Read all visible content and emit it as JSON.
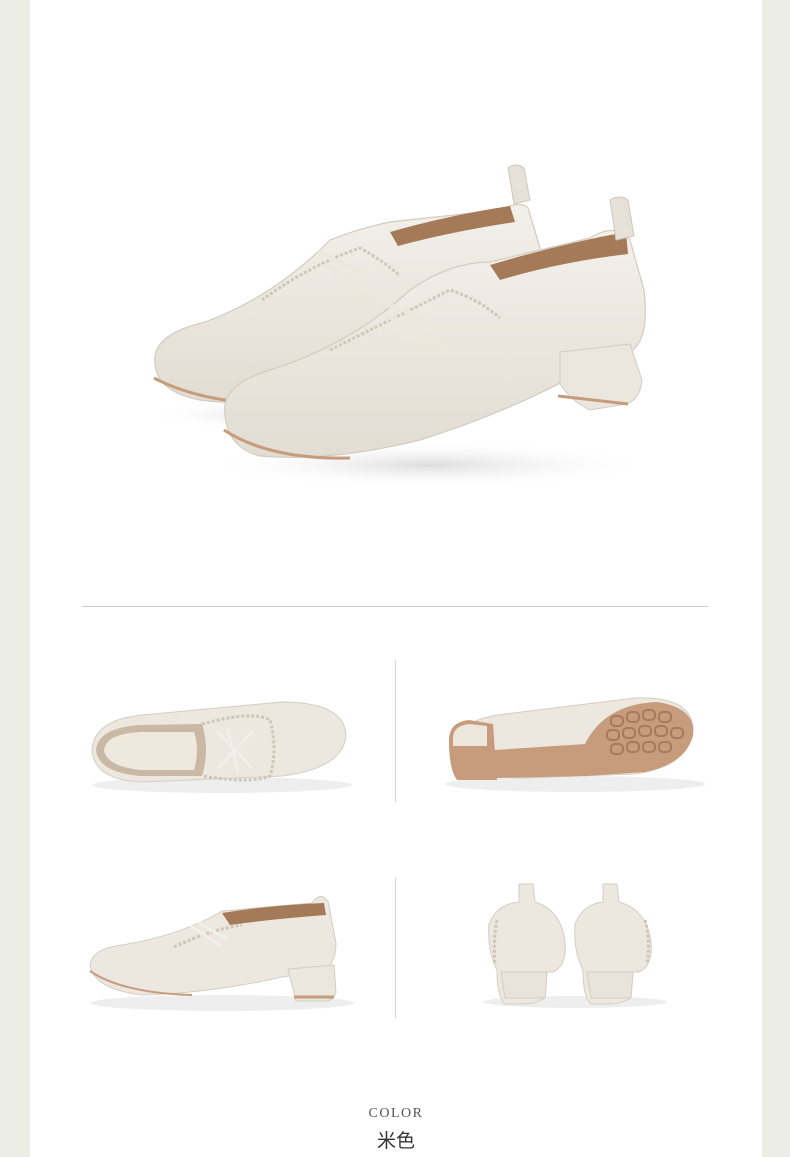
{
  "footer": {
    "color_label": "COLOR",
    "color_name": "米色"
  },
  "palette": {
    "leather": "#ebe7df",
    "leather_shade": "#d8d2c6",
    "lining": "#a47a58",
    "sole": "#c69c7c",
    "background": "#ffffff",
    "side_margin": "#eceee6"
  },
  "images": [
    {
      "id": "hero",
      "subject": "pair-of-lace-up-shoes"
    },
    {
      "id": "top-view",
      "subject": "shoe-top-view"
    },
    {
      "id": "sole-view",
      "subject": "shoe-sole-view"
    },
    {
      "id": "side-view",
      "subject": "shoe-side-view"
    },
    {
      "id": "back-view",
      "subject": "shoe-back-view"
    }
  ]
}
